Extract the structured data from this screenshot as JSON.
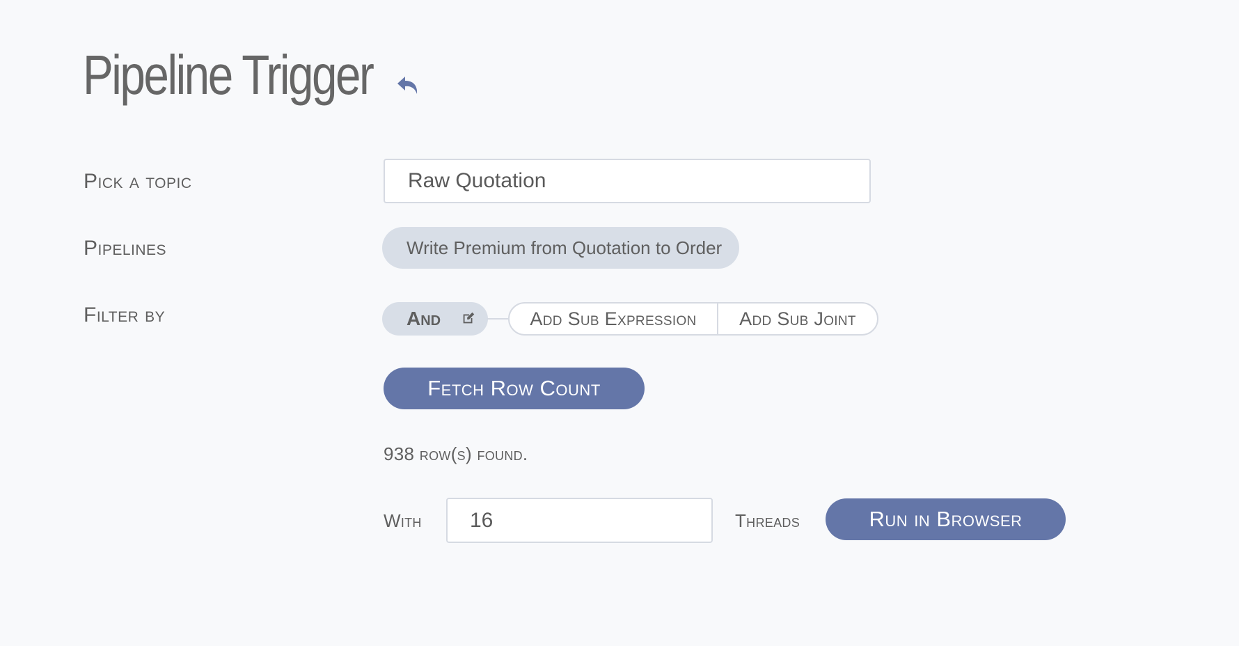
{
  "header": {
    "title": "Pipeline Trigger",
    "back_icon": "undo-arrow-icon",
    "accent_color": "#6476a8"
  },
  "form": {
    "topic": {
      "label": "Pick a topic",
      "value": "Raw Quotation"
    },
    "pipelines": {
      "label": "Pipelines",
      "items": [
        "Write Premium from Quotation to Order"
      ]
    },
    "filter": {
      "label": "Filter by",
      "joint_label": "And",
      "joint_icon": "edit-icon",
      "add_sub_expression_label": "Add Sub Expression",
      "add_sub_joint_label": "Add Sub Joint"
    },
    "fetch_button_label": "Fetch Row Count",
    "row_count_text": "938 row(s) found.",
    "threads": {
      "prefix_label": "With",
      "value": "16",
      "suffix_label": "Threads"
    },
    "run_button_label": "Run in Browser"
  }
}
